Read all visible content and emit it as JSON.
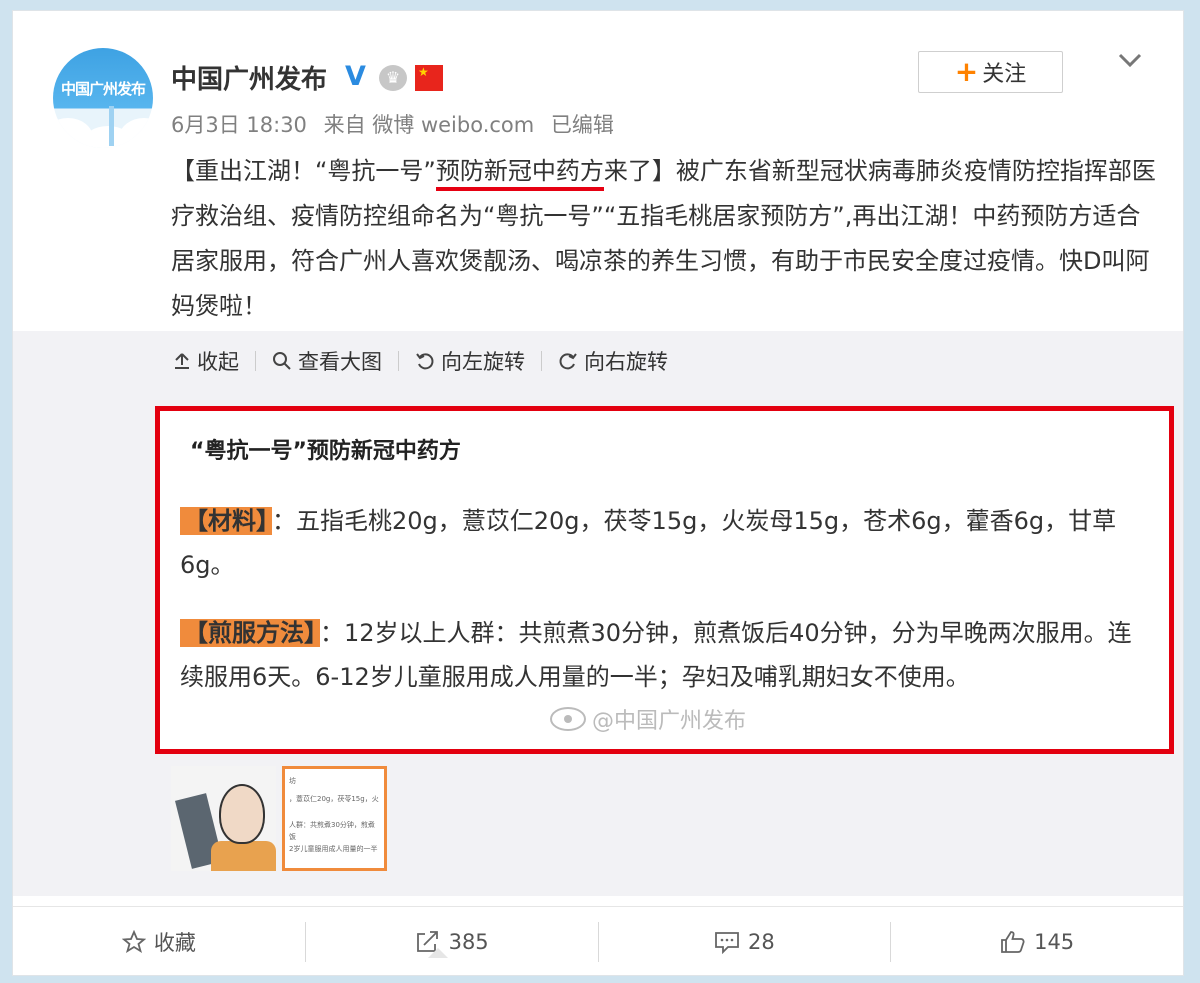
{
  "user": {
    "name": "中国广州发布",
    "avatar_text": "中国广州发布",
    "verified_mark": "V",
    "meta": {
      "date": "6月3日 18:30",
      "source": "来自 微博 weibo.com",
      "edited": "已编辑"
    }
  },
  "follow_button": {
    "plus": "+",
    "label": "关注"
  },
  "post": {
    "text_before_underline": "【重出江湖！“粤抗一号”",
    "text_underlined": "预防新冠中药方",
    "text_after_underline": "来了】被广东省新型冠状病毒肺炎疫情防控指挥部医疗救治组、疫情防控组命名为“粤抗一号”“五指毛桃居家预防方”,再出江湖！中药预防方适合居家服用，符合广州人喜欢煲靓汤、喝凉茶的养生习惯，有助于市民安全度过疫情。快D叫阿妈煲啦！"
  },
  "toolbar": {
    "collapse": "收起",
    "view_large": "查看大图",
    "rotate_left": "向左旋转",
    "rotate_right": "向右旋转"
  },
  "image": {
    "title": "“粤抗一号”预防新冠中药方",
    "materials_tag": "【材料】",
    "materials_text": "：五指毛桃20g，薏苡仁20g，茯苓15g，火炭母15g，苍术6g，藿香6g，甘草6g。",
    "method_tag": "【煎服方法】",
    "method_text": "：12岁以上人群：共煎煮30分钟，煎煮饭后40分钟，分为早晚两次服用。连续服用6天。6-12岁儿童服用成人用量的一半；孕妇及哺乳期妇女不使用。",
    "watermark": "@中国广州发布"
  },
  "thumbnail2_lines": [
    "坊",
    "，薏苡仁20g，茯苓15g，火",
    "人群：共煎煮30分钟，煎煮饭",
    "2岁儿童服用成人用量的一半"
  ],
  "actions": {
    "favorite": "收藏",
    "repost_count": "385",
    "comment_count": "28",
    "like_count": "145"
  },
  "colors": {
    "accent_orange": "#ff8200",
    "highlight_red": "#e3000f",
    "tag_orange": "#f08b3c",
    "verified_blue": "#2b8be0"
  }
}
